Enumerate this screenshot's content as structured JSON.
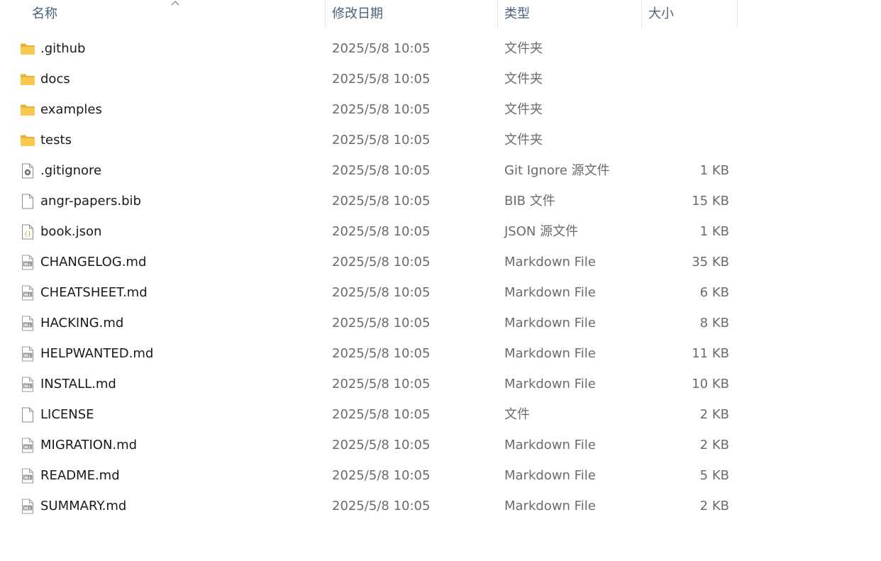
{
  "columns": {
    "name": "名称",
    "date": "修改日期",
    "type": "类型",
    "size": "大小"
  },
  "sort": {
    "column": "name",
    "direction": "ascending",
    "icon": "chevron-up-icon"
  },
  "colors": {
    "header_text": "#4c607a",
    "folder": "#f8c94d",
    "detail_text": "#6b6b6b"
  },
  "files": [
    {
      "name": ".github",
      "date": "2025/5/8 10:05",
      "type": "文件夹",
      "size": "",
      "icon": "folder-icon"
    },
    {
      "name": "docs",
      "date": "2025/5/8 10:05",
      "type": "文件夹",
      "size": "",
      "icon": "folder-icon"
    },
    {
      "name": "examples",
      "date": "2025/5/8 10:05",
      "type": "文件夹",
      "size": "",
      "icon": "folder-icon"
    },
    {
      "name": "tests",
      "date": "2025/5/8 10:05",
      "type": "文件夹",
      "size": "",
      "icon": "folder-icon"
    },
    {
      "name": ".gitignore",
      "date": "2025/5/8 10:05",
      "type": "Git Ignore 源文件",
      "size": "1 KB",
      "icon": "settings-file-icon"
    },
    {
      "name": "angr-papers.bib",
      "date": "2025/5/8 10:05",
      "type": "BIB 文件",
      "size": "15 KB",
      "icon": "blank-file-icon"
    },
    {
      "name": "book.json",
      "date": "2025/5/8 10:05",
      "type": "JSON 源文件",
      "size": "1 KB",
      "icon": "json-file-icon"
    },
    {
      "name": "CHANGELOG.md",
      "date": "2025/5/8 10:05",
      "type": "Markdown File",
      "size": "35 KB",
      "icon": "markdown-file-icon"
    },
    {
      "name": "CHEATSHEET.md",
      "date": "2025/5/8 10:05",
      "type": "Markdown File",
      "size": "6 KB",
      "icon": "markdown-file-icon"
    },
    {
      "name": "HACKING.md",
      "date": "2025/5/8 10:05",
      "type": "Markdown File",
      "size": "8 KB",
      "icon": "markdown-file-icon"
    },
    {
      "name": "HELPWANTED.md",
      "date": "2025/5/8 10:05",
      "type": "Markdown File",
      "size": "11 KB",
      "icon": "markdown-file-icon"
    },
    {
      "name": "INSTALL.md",
      "date": "2025/5/8 10:05",
      "type": "Markdown File",
      "size": "10 KB",
      "icon": "markdown-file-icon"
    },
    {
      "name": "LICENSE",
      "date": "2025/5/8 10:05",
      "type": "文件",
      "size": "2 KB",
      "icon": "blank-file-icon"
    },
    {
      "name": "MIGRATION.md",
      "date": "2025/5/8 10:05",
      "type": "Markdown File",
      "size": "2 KB",
      "icon": "markdown-file-icon"
    },
    {
      "name": "README.md",
      "date": "2025/5/8 10:05",
      "type": "Markdown File",
      "size": "5 KB",
      "icon": "markdown-file-icon"
    },
    {
      "name": "SUMMARY.md",
      "date": "2025/5/8 10:05",
      "type": "Markdown File",
      "size": "2 KB",
      "icon": "markdown-file-icon"
    }
  ]
}
